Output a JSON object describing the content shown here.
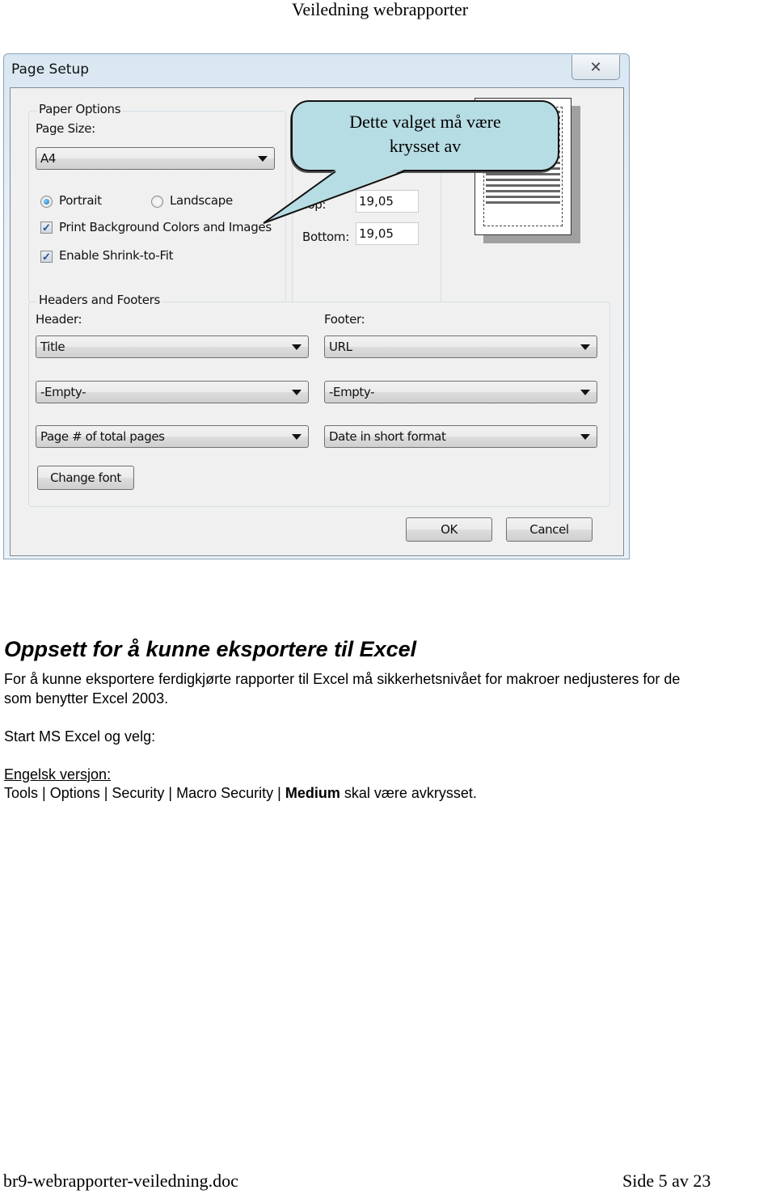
{
  "page_header": "Veiledning webrapporter",
  "dialog": {
    "title": "Page Setup",
    "close_glyph": "✕",
    "paper_options": {
      "legend": "Paper Options",
      "page_size_label": "Page Size:",
      "page_size_value": "A4",
      "orientation": [
        {
          "label": "Portrait",
          "checked": true
        },
        {
          "label": "Landscape",
          "checked": false
        }
      ],
      "print_background": {
        "label": "Print Background Colors and Images",
        "checked": true
      },
      "shrink_to_fit": {
        "label": "Enable Shrink-to-Fit",
        "checked": true
      }
    },
    "margins": {
      "top_label": "Top:",
      "top_value": "19,05",
      "bottom_label": "Bottom:",
      "bottom_value": "19,05"
    },
    "headers_footers": {
      "legend": "Headers and Footers",
      "header_label": "Header:",
      "footer_label": "Footer:",
      "header_values": [
        "Title",
        "-Empty-",
        "Page # of total pages"
      ],
      "footer_values": [
        "URL",
        "-Empty-",
        "Date in short format"
      ],
      "change_font_label": "Change font"
    },
    "ok_label": "OK",
    "cancel_label": "Cancel",
    "check_glyph": "✓"
  },
  "callout": {
    "line1": "Dette valget må være",
    "line2": "krysset av",
    "fill_color": "#b7dde4"
  },
  "section": {
    "title": "Oppsett for å kunne eksportere til Excel",
    "para1_line1": "For å kunne eksportere ferdigkjørte rapporter til Excel må sikkerhetsnivået for makroer nedjusteres for de",
    "para1_line2": "som benytter Excel 2003.",
    "para2": "Start MS Excel og velg:",
    "version_label": "Engelsk versjon:",
    "path_prefix": "Tools | Options | Security | Macro Security | ",
    "path_bold": "Medium",
    "path_suffix": " skal være avkrysset."
  },
  "page_footer": {
    "filename": "br9-webrapporter-veiledning.doc",
    "page_indicator": "Side 5 av 23"
  }
}
